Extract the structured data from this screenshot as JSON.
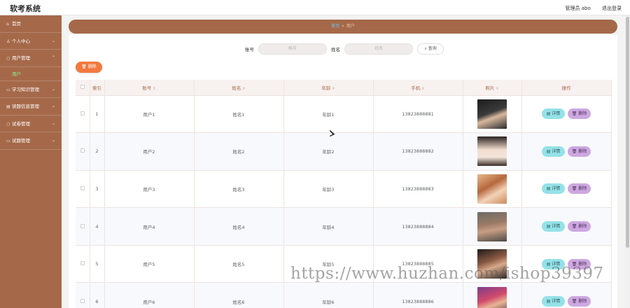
{
  "app": {
    "title": "软考系统"
  },
  "header": {
    "user_label": "管理员 abo",
    "logout_label": "退出登录"
  },
  "sidebar": {
    "items": [
      {
        "label": "首页",
        "icon": "home-icon",
        "has_children": false
      },
      {
        "label": "个人中心",
        "icon": "user-icon",
        "has_children": true
      },
      {
        "label": "用户管理",
        "icon": "users-icon",
        "has_children": true,
        "expanded": true,
        "children": [
          {
            "label": "用户",
            "active": true
          }
        ]
      },
      {
        "label": "学习知识管理",
        "icon": "book-icon",
        "has_children": true
      },
      {
        "label": "读题信息管理",
        "icon": "list-icon",
        "has_children": true
      },
      {
        "label": "试卷管理",
        "icon": "paper-icon",
        "has_children": true
      },
      {
        "label": "试题管理",
        "icon": "question-icon",
        "has_children": true
      }
    ]
  },
  "breadcrumb": {
    "home": "首页",
    "current": "用户"
  },
  "search": {
    "account_label": "账号",
    "account_placeholder": "账号",
    "name_label": "姓名",
    "name_placeholder": "姓名",
    "search_button": "查询"
  },
  "toolbar": {
    "batch_delete": "删除"
  },
  "table": {
    "columns": [
      "索引",
      "账号",
      "姓名",
      "年龄",
      "手机",
      "照片",
      "操作"
    ],
    "rows": [
      {
        "index": "1",
        "account": "用户1",
        "name": "姓名1",
        "age": "年龄1",
        "phone": "13823888881"
      },
      {
        "index": "2",
        "account": "用户2",
        "name": "姓名2",
        "age": "年龄2",
        "phone": "13823888882"
      },
      {
        "index": "3",
        "account": "用户3",
        "name": "姓名3",
        "age": "年龄3",
        "phone": "13823888883"
      },
      {
        "index": "4",
        "account": "用户4",
        "name": "姓名4",
        "age": "年龄4",
        "phone": "13823888884"
      },
      {
        "index": "5",
        "account": "用户5",
        "name": "姓名5",
        "age": "年龄5",
        "phone": "13823888885"
      },
      {
        "index": "6",
        "account": "用户6",
        "name": "姓名6",
        "age": "年龄6",
        "phone": "13823888886"
      }
    ],
    "row_actions": {
      "detail": "详情",
      "delete": "删除"
    }
  },
  "watermark": "https://www.huzhan.com/ishop39397",
  "colors": {
    "sidebar": "#a5694a",
    "accent_orange": "#f2793e",
    "detail_btn": "#94e2e8",
    "delete_btn": "#cda8e0"
  }
}
